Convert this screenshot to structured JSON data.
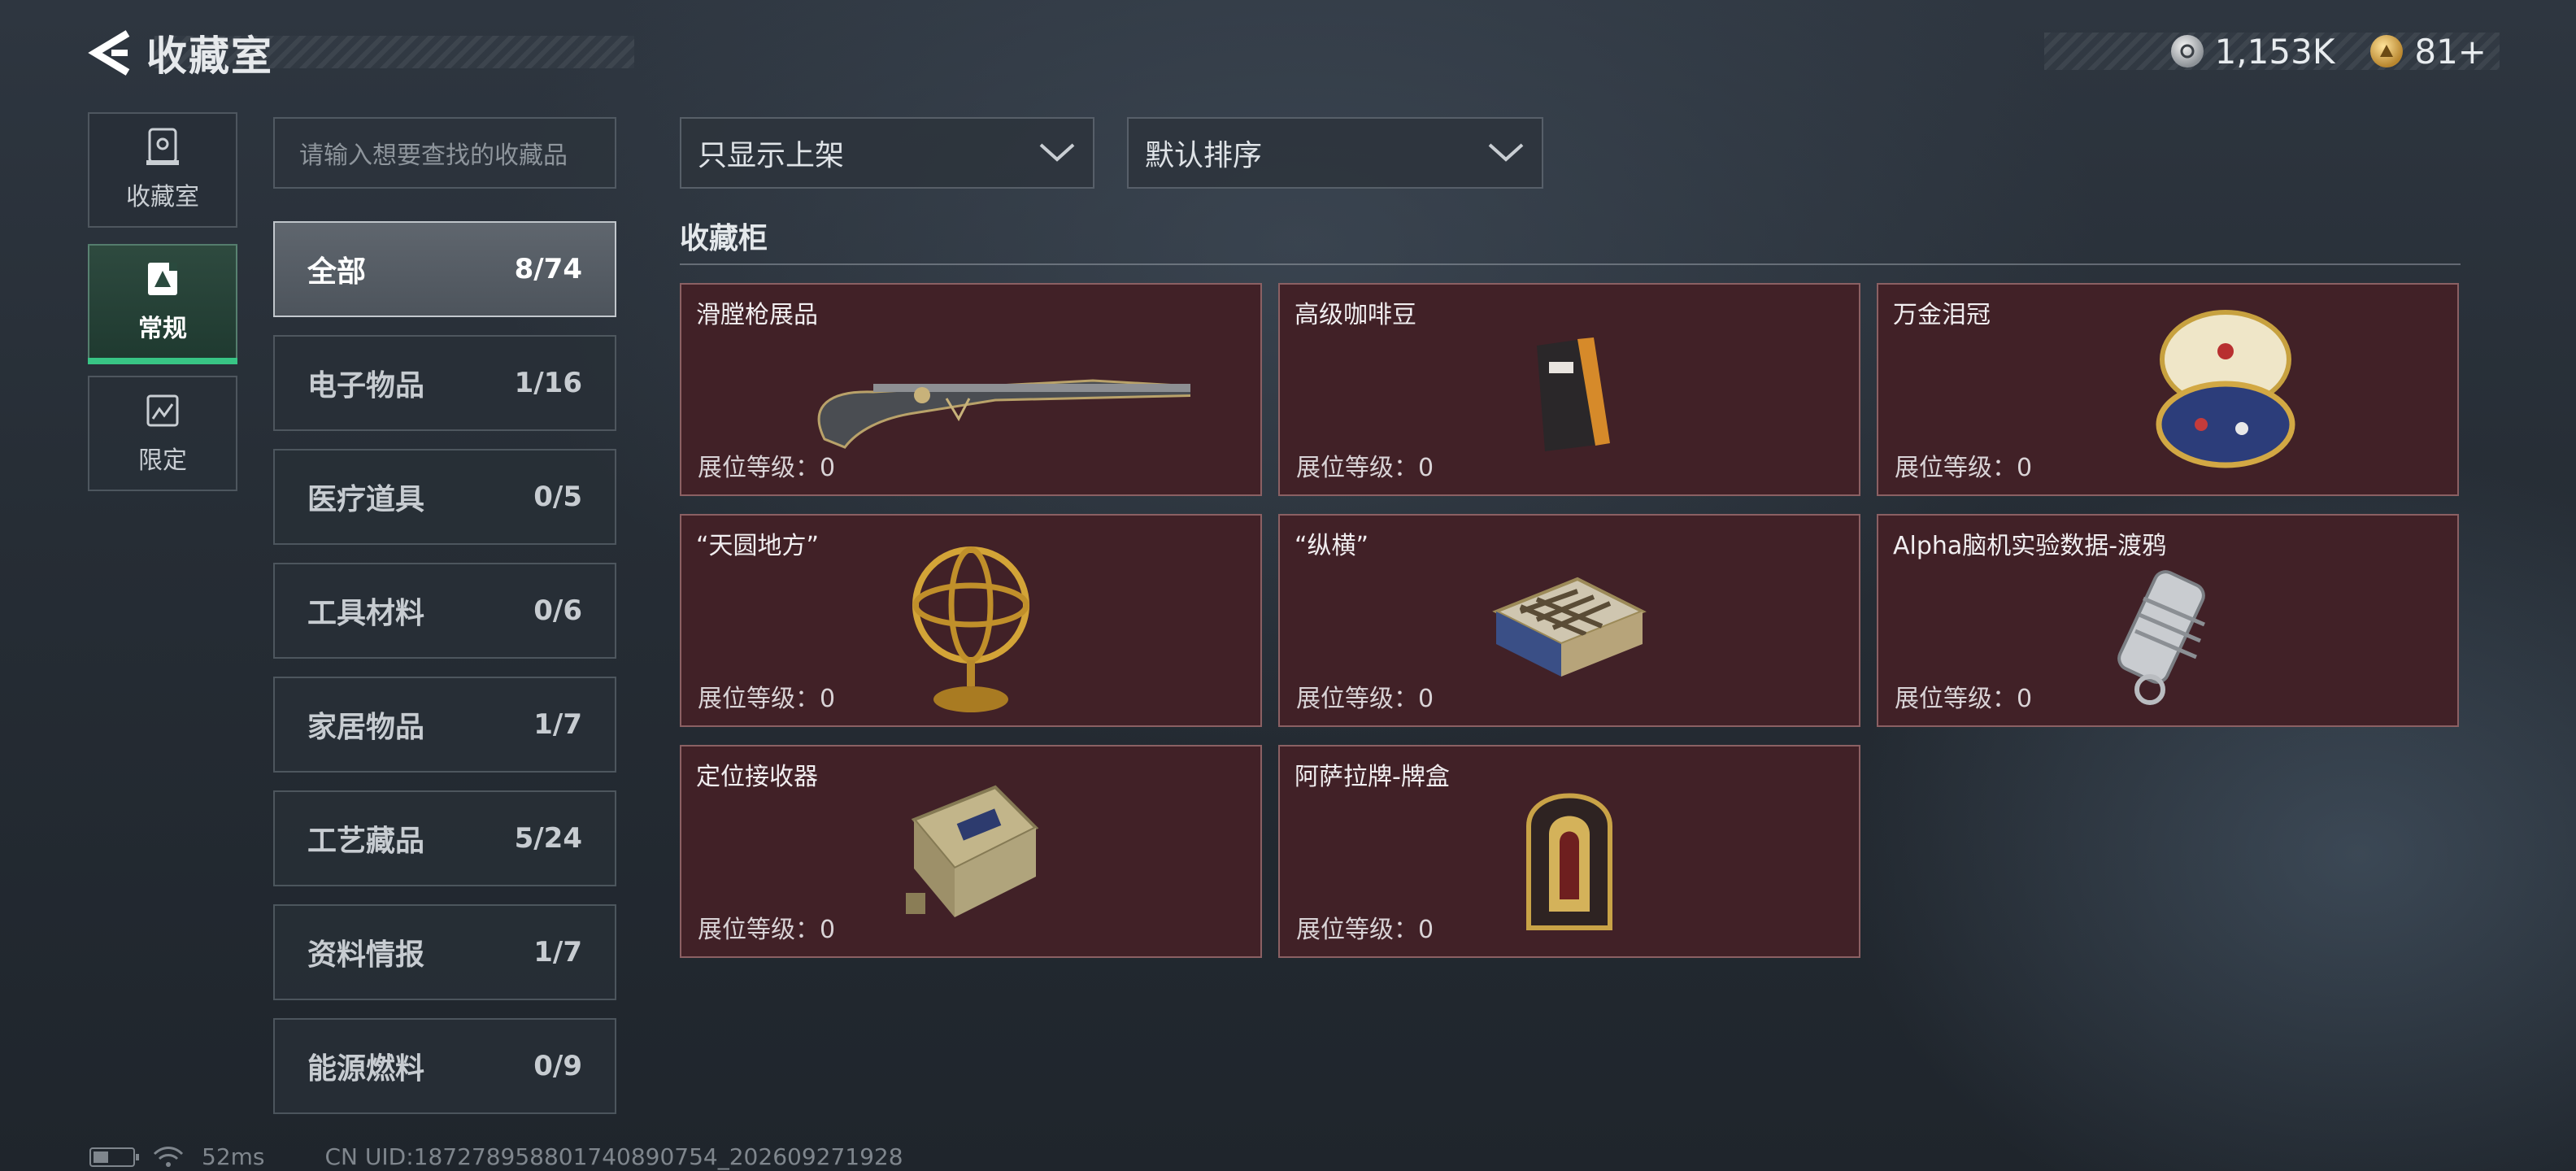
{
  "header": {
    "title": "收藏室"
  },
  "currency": {
    "silver": "1,153K",
    "gold": "81+"
  },
  "leftnav": [
    {
      "label": "收藏室"
    },
    {
      "label": "常规"
    },
    {
      "label": "限定"
    }
  ],
  "search": {
    "placeholder": "请输入想要查找的收藏品"
  },
  "categories": [
    {
      "label": "全部",
      "count": "8/74"
    },
    {
      "label": "电子物品",
      "count": "1/16"
    },
    {
      "label": "医疗道具",
      "count": "0/5"
    },
    {
      "label": "工具材料",
      "count": "0/6"
    },
    {
      "label": "家居物品",
      "count": "1/7"
    },
    {
      "label": "工艺藏品",
      "count": "5/24"
    },
    {
      "label": "资料情报",
      "count": "1/7"
    },
    {
      "label": "能源燃料",
      "count": "0/9"
    }
  ],
  "filters": {
    "filter": "只显示上架",
    "sort": "默认排序"
  },
  "section": {
    "title": "收藏柜"
  },
  "items": [
    {
      "name": "滑膛枪展品",
      "level": "展位等级：0"
    },
    {
      "name": "高级咖啡豆",
      "level": "展位等级：0"
    },
    {
      "name": "万金泪冠",
      "level": "展位等级：0"
    },
    {
      "name": "“天圆地方”",
      "level": "展位等级：0"
    },
    {
      "name": "“纵横”",
      "level": "展位等级：0"
    },
    {
      "name": "Alpha脑机实验数据-渡鸦",
      "level": "展位等级：0"
    },
    {
      "name": "定位接收器",
      "level": "展位等级：0"
    },
    {
      "name": "阿萨拉牌-牌盒",
      "level": "展位等级：0"
    }
  ],
  "footer": {
    "ping": "52ms",
    "uid": "CN UID:1872789588017408907​54_202609271928"
  },
  "colors": {
    "accent": "#38c585",
    "card_bg": "#412127"
  }
}
